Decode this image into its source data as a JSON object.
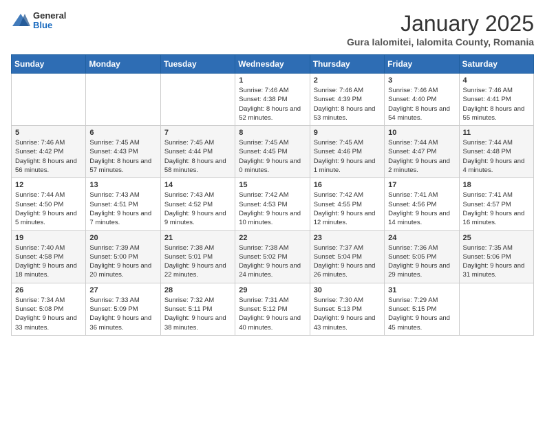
{
  "header": {
    "logo": {
      "general": "General",
      "blue": "Blue"
    },
    "month": "January 2025",
    "location": "Gura Ialomitei, Ialomita County, Romania"
  },
  "weekdays": [
    "Sunday",
    "Monday",
    "Tuesday",
    "Wednesday",
    "Thursday",
    "Friday",
    "Saturday"
  ],
  "weeks": [
    [
      {
        "day": "",
        "info": ""
      },
      {
        "day": "",
        "info": ""
      },
      {
        "day": "",
        "info": ""
      },
      {
        "day": "1",
        "info": "Sunrise: 7:46 AM\nSunset: 4:38 PM\nDaylight: 8 hours and 52 minutes."
      },
      {
        "day": "2",
        "info": "Sunrise: 7:46 AM\nSunset: 4:39 PM\nDaylight: 8 hours and 53 minutes."
      },
      {
        "day": "3",
        "info": "Sunrise: 7:46 AM\nSunset: 4:40 PM\nDaylight: 8 hours and 54 minutes."
      },
      {
        "day": "4",
        "info": "Sunrise: 7:46 AM\nSunset: 4:41 PM\nDaylight: 8 hours and 55 minutes."
      }
    ],
    [
      {
        "day": "5",
        "info": "Sunrise: 7:46 AM\nSunset: 4:42 PM\nDaylight: 8 hours and 56 minutes."
      },
      {
        "day": "6",
        "info": "Sunrise: 7:45 AM\nSunset: 4:43 PM\nDaylight: 8 hours and 57 minutes."
      },
      {
        "day": "7",
        "info": "Sunrise: 7:45 AM\nSunset: 4:44 PM\nDaylight: 8 hours and 58 minutes."
      },
      {
        "day": "8",
        "info": "Sunrise: 7:45 AM\nSunset: 4:45 PM\nDaylight: 9 hours and 0 minutes."
      },
      {
        "day": "9",
        "info": "Sunrise: 7:45 AM\nSunset: 4:46 PM\nDaylight: 9 hours and 1 minute."
      },
      {
        "day": "10",
        "info": "Sunrise: 7:44 AM\nSunset: 4:47 PM\nDaylight: 9 hours and 2 minutes."
      },
      {
        "day": "11",
        "info": "Sunrise: 7:44 AM\nSunset: 4:48 PM\nDaylight: 9 hours and 4 minutes."
      }
    ],
    [
      {
        "day": "12",
        "info": "Sunrise: 7:44 AM\nSunset: 4:50 PM\nDaylight: 9 hours and 5 minutes."
      },
      {
        "day": "13",
        "info": "Sunrise: 7:43 AM\nSunset: 4:51 PM\nDaylight: 9 hours and 7 minutes."
      },
      {
        "day": "14",
        "info": "Sunrise: 7:43 AM\nSunset: 4:52 PM\nDaylight: 9 hours and 9 minutes."
      },
      {
        "day": "15",
        "info": "Sunrise: 7:42 AM\nSunset: 4:53 PM\nDaylight: 9 hours and 10 minutes."
      },
      {
        "day": "16",
        "info": "Sunrise: 7:42 AM\nSunset: 4:55 PM\nDaylight: 9 hours and 12 minutes."
      },
      {
        "day": "17",
        "info": "Sunrise: 7:41 AM\nSunset: 4:56 PM\nDaylight: 9 hours and 14 minutes."
      },
      {
        "day": "18",
        "info": "Sunrise: 7:41 AM\nSunset: 4:57 PM\nDaylight: 9 hours and 16 minutes."
      }
    ],
    [
      {
        "day": "19",
        "info": "Sunrise: 7:40 AM\nSunset: 4:58 PM\nDaylight: 9 hours and 18 minutes."
      },
      {
        "day": "20",
        "info": "Sunrise: 7:39 AM\nSunset: 5:00 PM\nDaylight: 9 hours and 20 minutes."
      },
      {
        "day": "21",
        "info": "Sunrise: 7:38 AM\nSunset: 5:01 PM\nDaylight: 9 hours and 22 minutes."
      },
      {
        "day": "22",
        "info": "Sunrise: 7:38 AM\nSunset: 5:02 PM\nDaylight: 9 hours and 24 minutes."
      },
      {
        "day": "23",
        "info": "Sunrise: 7:37 AM\nSunset: 5:04 PM\nDaylight: 9 hours and 26 minutes."
      },
      {
        "day": "24",
        "info": "Sunrise: 7:36 AM\nSunset: 5:05 PM\nDaylight: 9 hours and 29 minutes."
      },
      {
        "day": "25",
        "info": "Sunrise: 7:35 AM\nSunset: 5:06 PM\nDaylight: 9 hours and 31 minutes."
      }
    ],
    [
      {
        "day": "26",
        "info": "Sunrise: 7:34 AM\nSunset: 5:08 PM\nDaylight: 9 hours and 33 minutes."
      },
      {
        "day": "27",
        "info": "Sunrise: 7:33 AM\nSunset: 5:09 PM\nDaylight: 9 hours and 36 minutes."
      },
      {
        "day": "28",
        "info": "Sunrise: 7:32 AM\nSunset: 5:11 PM\nDaylight: 9 hours and 38 minutes."
      },
      {
        "day": "29",
        "info": "Sunrise: 7:31 AM\nSunset: 5:12 PM\nDaylight: 9 hours and 40 minutes."
      },
      {
        "day": "30",
        "info": "Sunrise: 7:30 AM\nSunset: 5:13 PM\nDaylight: 9 hours and 43 minutes."
      },
      {
        "day": "31",
        "info": "Sunrise: 7:29 AM\nSunset: 5:15 PM\nDaylight: 9 hours and 45 minutes."
      },
      {
        "day": "",
        "info": ""
      }
    ]
  ]
}
